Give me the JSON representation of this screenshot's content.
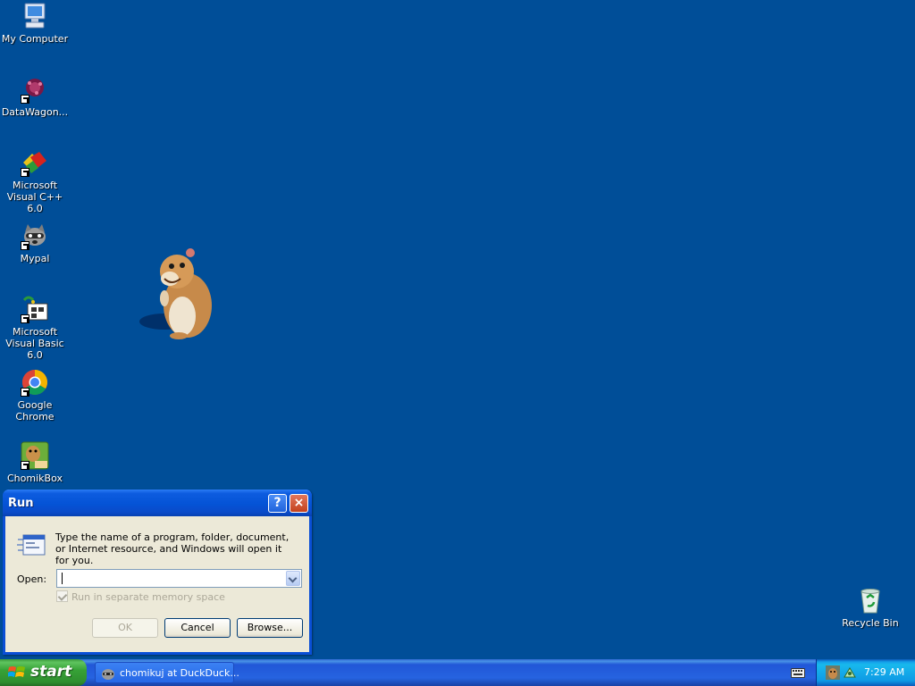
{
  "desktop": {
    "background_color": "#004e98",
    "icons": [
      {
        "label": "My Computer",
        "icon": "computer-icon"
      },
      {
        "label": "DataWagon...",
        "icon": "datawagon-icon"
      },
      {
        "label": "Microsoft Visual C++ 6.0",
        "icon": "visual-cpp-icon"
      },
      {
        "label": "Mypal",
        "icon": "raccoon-icon"
      },
      {
        "label": "Microsoft Visual Basic 6.0",
        "icon": "visual-basic-icon"
      },
      {
        "label": "Google Chrome",
        "icon": "chrome-icon"
      },
      {
        "label": "ChomikBox",
        "icon": "chomikbox-icon"
      },
      {
        "label": "Recycle Bin",
        "icon": "recycle-bin-icon"
      }
    ]
  },
  "run_dialog": {
    "title": "Run",
    "help_label": "?",
    "close_label": "×",
    "description": "Type the name of a program, folder, document, or Internet resource, and Windows will open it for you.",
    "open_label": "Open:",
    "open_value": "",
    "memory_label": "Run in separate memory space",
    "memory_checked": true,
    "ok_label": "OK",
    "cancel_label": "Cancel",
    "browse_label": "Browse..."
  },
  "taskbar": {
    "start_label": "start",
    "task_label": "chomikuj at DuckDuck...",
    "clock": "7:29 AM"
  }
}
